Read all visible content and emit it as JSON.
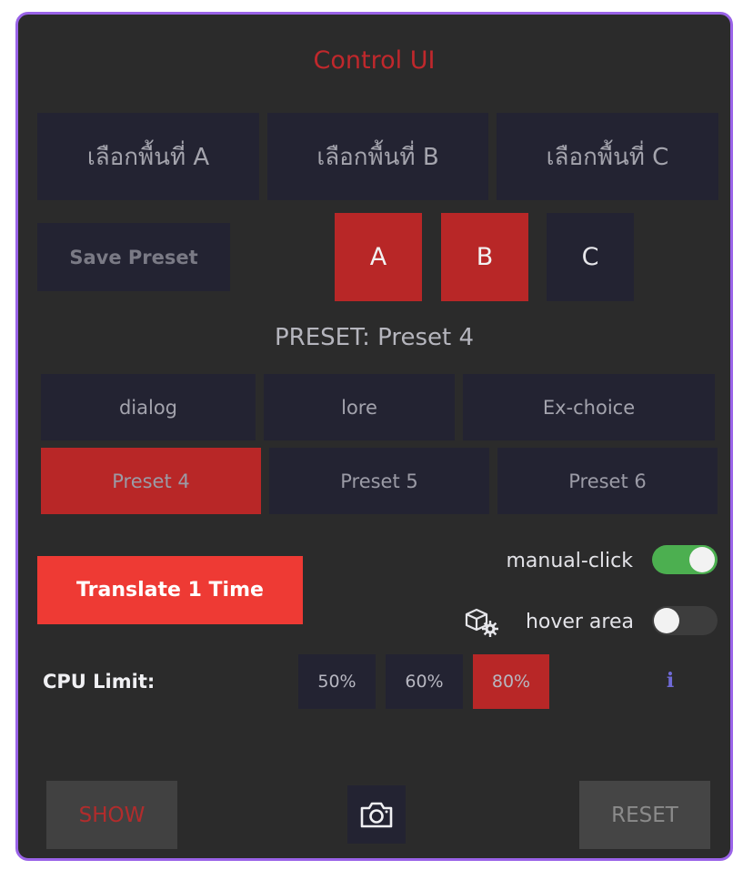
{
  "header": {
    "title": "Control UI"
  },
  "areas": [
    {
      "label": "เลือกพื้นที่ A"
    },
    {
      "label": "เลือกพื้นที่ B"
    },
    {
      "label": "เลือกพื้นที่ C"
    }
  ],
  "save_preset_label": "Save Preset",
  "slots": [
    {
      "label": "A",
      "active": true
    },
    {
      "label": "B",
      "active": true
    },
    {
      "label": "C",
      "active": false
    }
  ],
  "preset_status": "PRESET: Preset 4",
  "categories": [
    {
      "label": "dialog"
    },
    {
      "label": "lore"
    },
    {
      "label": "Ex-choice"
    }
  ],
  "presets": [
    {
      "label": "Preset 4",
      "active": true
    },
    {
      "label": "Preset 5",
      "active": false
    },
    {
      "label": "Preset 6",
      "active": false
    }
  ],
  "translate_label": "Translate 1 Time",
  "toggles": {
    "manual_click": {
      "label": "manual-click",
      "on": true
    },
    "hover_area": {
      "label": "hover area",
      "on": false,
      "icon": "cube-gear-icon"
    }
  },
  "cpu": {
    "label": "CPU Limit:",
    "options": [
      {
        "label": "50%",
        "active": false
      },
      {
        "label": "60%",
        "active": false
      },
      {
        "label": "80%",
        "active": true
      }
    ],
    "info_glyph": "i"
  },
  "footer": {
    "show_label": "SHOW",
    "reset_label": "RESET",
    "camera_icon": "camera-icon"
  },
  "colors": {
    "accent_red": "#b82727",
    "translate_red": "#ee3a34",
    "toggle_on": "#4caf50",
    "toggle_off": "#3d3d3d",
    "border_purple": "#9a63e8"
  }
}
